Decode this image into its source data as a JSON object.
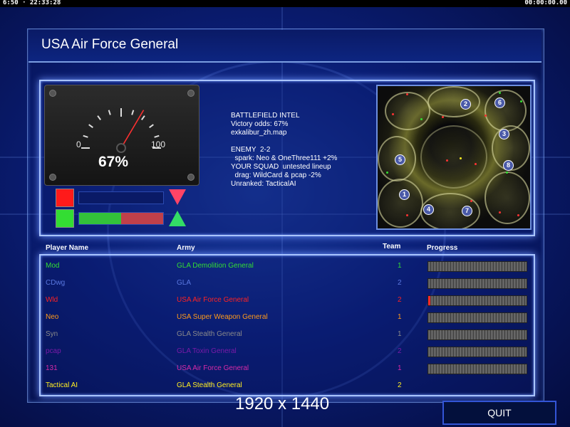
{
  "status_bar": {
    "left_clock": "6:50 · 22:33:28",
    "right_clock": "00:00:00.00"
  },
  "header": {
    "title": "USA Air Force General"
  },
  "gauge": {
    "min_label": "0",
    "max_label": "100",
    "value_label": "67%",
    "value": 67
  },
  "odds_bars": {
    "top_color": "#ff1a1a",
    "bottom_color": "#33dd33",
    "bottom_green_fraction": 0.5
  },
  "intel": {
    "lines": [
      "BATTLEFIELD INTEL",
      "Victory odds: 67%",
      "exkalibur_zh.map",
      "",
      "ENEMY  2-2",
      "  spark: Neo & OneThree111 +2%",
      "YOUR SQUAD  untested lineup",
      "  drag: WildCard & pcap -2%",
      "Unranked: TacticalAI"
    ]
  },
  "minimap": {
    "start_positions": [
      "1",
      "2",
      "3",
      "4",
      "5",
      "6",
      "7",
      "8"
    ]
  },
  "table": {
    "headers": {
      "name": "Player Name",
      "army": "Army",
      "team": "Team",
      "progress": "Progress"
    },
    "rows": [
      {
        "name": "Mod",
        "army": "GLA Demolition General",
        "team": "1",
        "color": "#33dd33",
        "progress": 0.0,
        "show_progress": true
      },
      {
        "name": "CDwg",
        "army": "GLA",
        "team": "2",
        "color": "#5a78e0",
        "progress": 0.0,
        "show_progress": true
      },
      {
        "name": "Wld",
        "army": "USA Air Force General",
        "team": "2",
        "color": "#ff2222",
        "progress": 0.02,
        "show_progress": true
      },
      {
        "name": "Neo",
        "army": "USA Super Weapon General",
        "team": "1",
        "color": "#ff9a1a",
        "progress": 0.0,
        "show_progress": true
      },
      {
        "name": "Syn",
        "army": "GLA Stealth General",
        "team": "1",
        "color": "#8a8a8a",
        "progress": 0.0,
        "show_progress": true
      },
      {
        "name": "pcap",
        "army": "GLA Toxin General",
        "team": "2",
        "color": "#7a1aa8",
        "progress": 0.0,
        "show_progress": true
      },
      {
        "name": "131",
        "army": "USA Air Force General",
        "team": "1",
        "color": "#d82aa8",
        "progress": 0.0,
        "show_progress": true
      },
      {
        "name": "Tactical AI",
        "army": "GLA Stealth General",
        "team": "2",
        "color": "#ffee22",
        "progress": 0.0,
        "show_progress": false
      }
    ]
  },
  "resolution_text": "1920 x 1440",
  "quit_label": "QUIT"
}
